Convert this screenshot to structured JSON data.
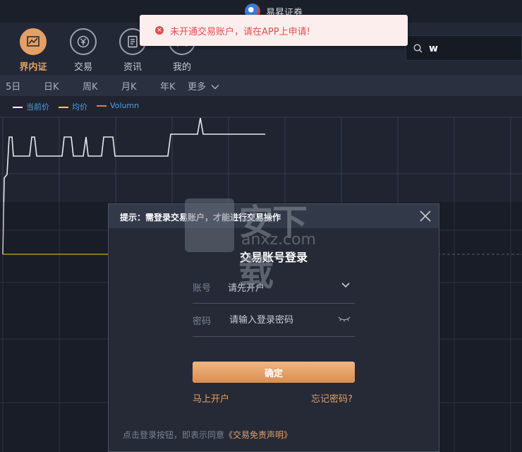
{
  "window": {
    "title": "易昇证券"
  },
  "nav": {
    "items": [
      {
        "label": "界内证",
        "icon": "chart-icon",
        "active": true
      },
      {
        "label": "交易",
        "icon": "yen-icon",
        "active": false
      },
      {
        "label": "资讯",
        "icon": "document-icon",
        "active": false
      },
      {
        "label": "我的",
        "icon": "user-icon",
        "active": false
      }
    ]
  },
  "search": {
    "value": "w"
  },
  "toast": {
    "message": "未开通交易账户，请在APP上申请!"
  },
  "periods": [
    "5日",
    "日K",
    "周K",
    "月K",
    "年K",
    "更多"
  ],
  "legend": [
    {
      "label": "当前价",
      "color": "#ffffff"
    },
    {
      "label": "均价",
      "color": "#f5d90a"
    },
    {
      "label": "Volumn",
      "color": "#e07b4f"
    }
  ],
  "dialog": {
    "hint": "提示：需登录交易账户，才能进行交易操作",
    "title": "交易账号登录",
    "account_label": "账号",
    "account_value": "请先开户",
    "password_label": "密码",
    "password_placeholder": "请输入登录密码",
    "confirm_label": "确定",
    "open_account_link": "马上开户",
    "forgot_password_link": "忘记密码?",
    "disclaimer_text": "点击登录按钮，即表示同意",
    "disclaimer_link": "《交易免责声明》"
  },
  "watermark": {
    "text": "安下载",
    "domain": "anxz.com"
  },
  "colors": {
    "accent": "#e3a066",
    "error": "#e05050",
    "legend_text": "#4d9fe3"
  }
}
